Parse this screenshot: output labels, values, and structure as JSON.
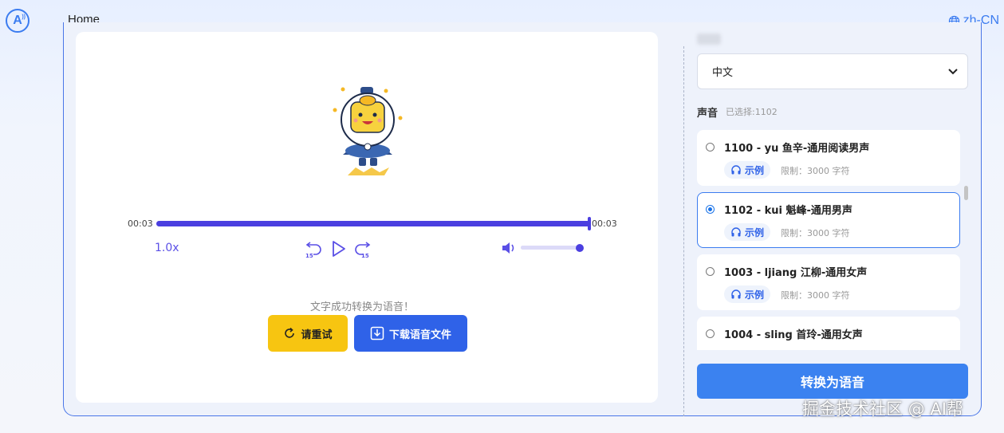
{
  "header": {
    "logo_text": "A",
    "home_label": "Home",
    "language": "zh-CN"
  },
  "player": {
    "current_time": "00:03",
    "total_time": "00:03",
    "progress": 1.0,
    "speed": "1.0x",
    "skip_back_seconds": "15",
    "skip_forward_seconds": "15",
    "volume": 1.0,
    "success_message": "文字成功转换为语音！",
    "retry_label": "请重试",
    "download_label": "下载语音文件"
  },
  "sidebar": {
    "language_select_value": "中文",
    "voice_label": "声音",
    "selected_text": "已选择:1102",
    "voices": [
      {
        "name": "1100 - yu 鱼辛-通用阅读男声",
        "sample": "示例",
        "limit": "限制：3000 字符",
        "selected": false
      },
      {
        "name": "1102 - kui 魁峰-通用男声",
        "sample": "示例",
        "limit": "限制：3000 字符",
        "selected": true
      },
      {
        "name": "1003 - ljiang 江柳-通用女声",
        "sample": "示例",
        "limit": "限制：3000 字符",
        "selected": false
      },
      {
        "name": "1004 - sling 首玲-通用女声",
        "sample": "",
        "limit": "",
        "selected": false
      }
    ],
    "convert_label": "转换为语音"
  },
  "watermark": "掘金技术社区 @ AI帮",
  "colors": {
    "accent": "#4b3fe0",
    "primary_blue": "#2f62e8",
    "retry_yellow": "#f7c511",
    "convert_blue": "#3b82f0"
  }
}
